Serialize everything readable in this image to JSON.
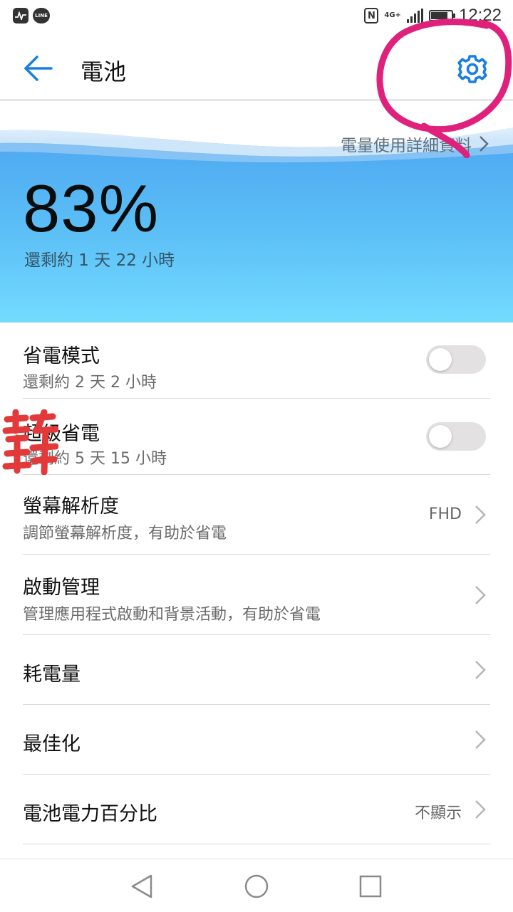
{
  "status_bar": {
    "time": "12:22",
    "network": "4G+",
    "line_label": "LINE",
    "nfc": "N",
    "battery_level": 0.83
  },
  "toolbar": {
    "title": "電池"
  },
  "hero": {
    "detail_link": "電量使用詳細資料",
    "percent": "83%",
    "remaining": "還剩約 1 天 22 小時"
  },
  "rows": [
    {
      "title": "省電模式",
      "subtitle": "還剩約 2 天 2 小時",
      "control": "toggle",
      "on": false
    },
    {
      "title": "超級省電",
      "subtitle": "還剩約 5 天 15 小時",
      "control": "toggle",
      "on": false
    },
    {
      "title": "螢幕解析度",
      "subtitle": "調節螢幕解析度，有助於省電",
      "value": "FHD",
      "control": "chevron"
    },
    {
      "title": "啟動管理",
      "subtitle": "管理應用程式啟動和背景活動，有助於省電",
      "control": "chevron"
    },
    {
      "title": "耗電量",
      "control": "chevron"
    },
    {
      "title": "最佳化",
      "control": "chevron"
    },
    {
      "title": "電池電力百分比",
      "value": "不顯示",
      "control": "chevron"
    }
  ],
  "stamp": {
    "text": "幹"
  },
  "colors": {
    "accent": "#1a7fe0",
    "annotation": "#e0217c",
    "hero_top": "#4fa9f2",
    "hero_bottom": "#74dbff"
  },
  "icons": {
    "back": "arrow-left-icon",
    "settings": "gear-icon",
    "chevron": "chevron-right-icon"
  }
}
